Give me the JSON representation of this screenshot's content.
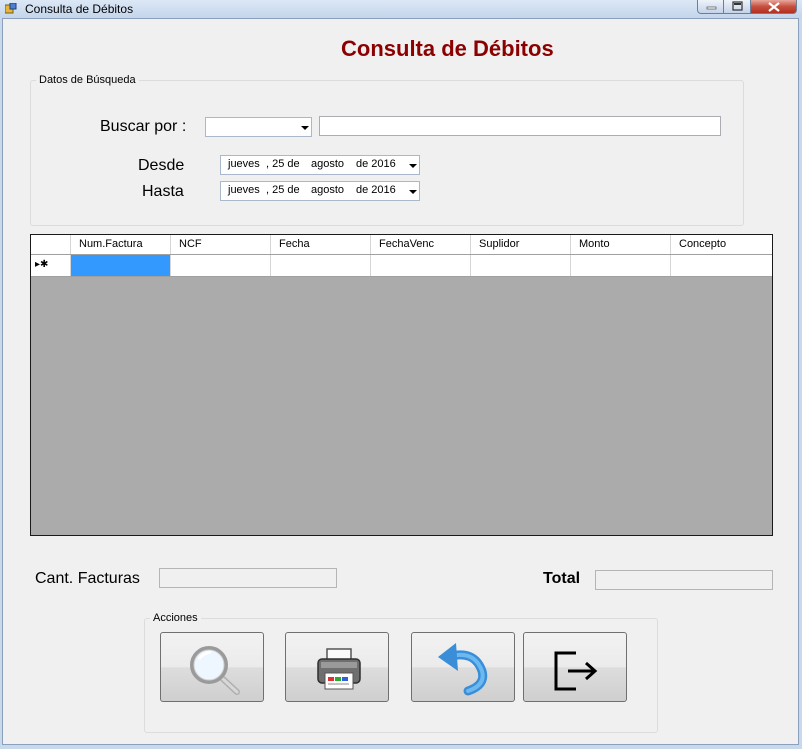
{
  "window": {
    "title": "Consulta de Débitos"
  },
  "heading": "Consulta de Débitos",
  "search_group": {
    "legend": "Datos de Búsqueda",
    "buscar_label": "Buscar por :",
    "buscar_selected": "",
    "search_value": "",
    "desde_label": "Desde",
    "hasta_label": "Hasta",
    "desde": {
      "weekday": "jueves",
      "day": ", 25 de",
      "month": "agosto",
      "year": "de 2016"
    },
    "hasta": {
      "weekday": "jueves",
      "day": ", 25 de",
      "month": "agosto",
      "year": "de 2016"
    }
  },
  "grid": {
    "columns": [
      "Num.Factura",
      "NCF",
      "Fecha",
      "FechaVenc",
      "Suplidor",
      "Monto",
      "Concepto"
    ],
    "new_row_indicator": "▸✱"
  },
  "summary": {
    "cant_label": "Cant. Facturas",
    "cant_value": "",
    "total_label": "Total",
    "total_value": ""
  },
  "actions": {
    "legend": "Acciones",
    "buttons": [
      {
        "icon": "magnifier-icon"
      },
      {
        "icon": "printer-icon"
      },
      {
        "icon": "undo-arrow-icon"
      },
      {
        "icon": "exit-icon"
      }
    ]
  },
  "colors": {
    "heading": "#8b0000",
    "grid_background": "#ababab",
    "selection": "#3399ff"
  }
}
